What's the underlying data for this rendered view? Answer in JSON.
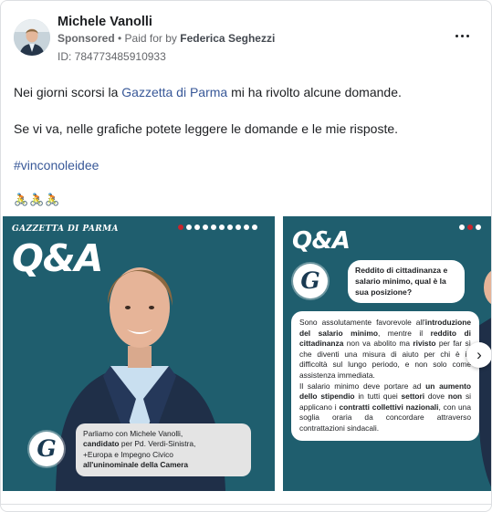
{
  "post": {
    "author": "Michele Vanolli",
    "sponsored": "Sponsored",
    "paid_prefix": " • Paid for by ",
    "payer": "Federica Seghezzi",
    "ad_id": "ID: 784773485910933",
    "line1_before": "Nei giorni scorsi la ",
    "line1_link": "Gazzetta di Parma",
    "line1_after": " mi ha rivolto alcune domande.",
    "line2": "Se vi va, nelle grafiche potete leggere le domande e le mie risposte.",
    "hashtag": "#vinconoleidee",
    "emoji_line": "🚴🚴🚴",
    "more_icon": "more-horizontal-icon"
  },
  "slide1": {
    "brand": "GAZZETTA DI PARMA",
    "title": "Q&A",
    "logo": "G",
    "caption": {
      "p1": "Parliamo con Michele Vanolli,",
      "p2_bold": "candidato",
      "p2_rest": " per Pd. Verdi-Sinistra,",
      "p3": "+Europa e Impegno Civico",
      "p4_bold": "all'uninominale della Camera"
    },
    "dots_total": 10,
    "dot_active": 0
  },
  "slide2": {
    "title": "Q&A",
    "logo": "G",
    "question": "Reddito di cittadinanza e salario minimo, qual è la sua posizione?",
    "answer": {
      "a1": "Sono assolutamente favorevole all'",
      "a1_b": "introduzione del salario minimo",
      "a1_c": ", mentre il ",
      "a2_b": "reddito di cittadinanza",
      "a2_c": " non va abolito ma ",
      "a3_b": "rivisto",
      "a3_c": " per far sì che diventi una misura di aiuto per chi è in difficoltà sul lungo periodo, e non solo come assistenza immediata.",
      "b1": "Il salario minimo deve portare ad ",
      "b1_b": "un aumento dello stipendio",
      "b1_c": " in tutti quei ",
      "b2_b": "settori",
      "b2_c": " dove ",
      "b3_b": "non",
      "b3_c": " si applicano i ",
      "b4_b": "contratti collettivi nazionali",
      "b4_c": ", con una soglia oraria da concordare attraverso contrattazioni sindacali."
    },
    "dots_total": 3,
    "dot_active": 1
  },
  "carousel": {
    "next_icon": "chevron-right-icon",
    "next_glyph": "›"
  },
  "colors": {
    "slide_bg": "#1f5e6e",
    "accent_red": "#c8242c",
    "link": "#385898"
  }
}
